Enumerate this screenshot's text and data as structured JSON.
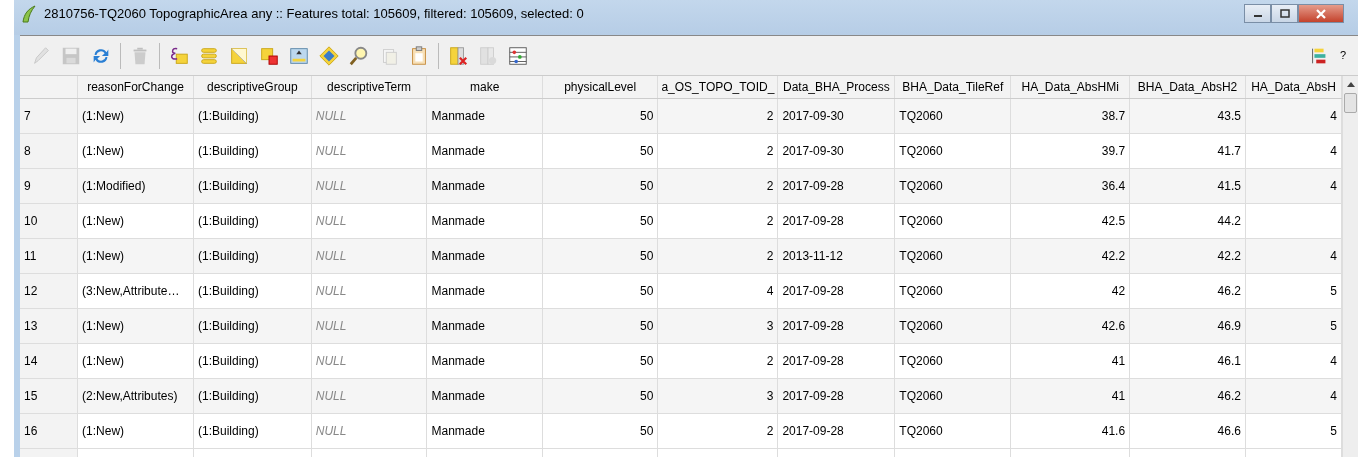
{
  "window": {
    "title": "2810756-TQ2060 TopographicArea any :: Features total: 105609, filtered: 105609, selected: 0"
  },
  "toolbar": {
    "groups": [
      [
        {
          "disabled": true
        },
        {
          "disabled": true
        },
        {
          "disabled": false
        }
      ],
      [
        {
          "disabled": true
        }
      ],
      [
        {
          "disabled": false
        },
        {
          "disabled": false
        },
        {
          "disabled": false
        },
        {
          "disabled": false
        },
        {
          "disabled": false
        },
        {
          "disabled": false
        },
        {
          "disabled": false
        },
        {
          "disabled": true
        },
        {
          "disabled": false
        }
      ],
      [
        {
          "disabled": false
        },
        {
          "disabled": true
        },
        {
          "disabled": false
        }
      ]
    ],
    "help": "?"
  },
  "table": {
    "columns": [
      {
        "label": "reasonForChange",
        "kind": "text"
      },
      {
        "label": "descriptiveGroup",
        "kind": "text"
      },
      {
        "label": "descriptiveTerm",
        "kind": "null"
      },
      {
        "label": "make",
        "kind": "text"
      },
      {
        "label": "physicalLevel",
        "kind": "number"
      },
      {
        "label": "a_OS_TOPO_TOID_",
        "kind": "number"
      },
      {
        "label": "Data_BHA_Process",
        "kind": "text"
      },
      {
        "label": "BHA_Data_TileRef",
        "kind": "text"
      },
      {
        "label": "HA_Data_AbsHMi",
        "kind": "number"
      },
      {
        "label": "BHA_Data_AbsH2",
        "kind": "number"
      },
      {
        "label": "HA_Data_AbsH",
        "kind": "number"
      }
    ],
    "rows": [
      {
        "id": "7",
        "cells": [
          "(1:New)",
          "(1:Building)",
          "NULL",
          "Manmade",
          "50",
          "2",
          "2017-09-30",
          "TQ2060",
          "38.7",
          "43.5",
          "4"
        ]
      },
      {
        "id": "8",
        "cells": [
          "(1:New)",
          "(1:Building)",
          "NULL",
          "Manmade",
          "50",
          "2",
          "2017-09-30",
          "TQ2060",
          "39.7",
          "41.7",
          "4"
        ]
      },
      {
        "id": "9",
        "cells": [
          "(1:Modified)",
          "(1:Building)",
          "NULL",
          "Manmade",
          "50",
          "2",
          "2017-09-28",
          "TQ2060",
          "36.4",
          "41.5",
          "4"
        ]
      },
      {
        "id": "10",
        "cells": [
          "(1:New)",
          "(1:Building)",
          "NULL",
          "Manmade",
          "50",
          "2",
          "2017-09-28",
          "TQ2060",
          "42.5",
          "44.2",
          null
        ]
      },
      {
        "id": "11",
        "cells": [
          "(1:New)",
          "(1:Building)",
          "NULL",
          "Manmade",
          "50",
          "2",
          "2013-11-12",
          "TQ2060",
          "42.2",
          "42.2",
          "4"
        ]
      },
      {
        "id": "12",
        "cells": [
          "(3:New,Attribute…",
          "(1:Building)",
          "NULL",
          "Manmade",
          "50",
          "4",
          "2017-09-28",
          "TQ2060",
          "42",
          "46.2",
          "5"
        ]
      },
      {
        "id": "13",
        "cells": [
          "(1:New)",
          "(1:Building)",
          "NULL",
          "Manmade",
          "50",
          "3",
          "2017-09-28",
          "TQ2060",
          "42.6",
          "46.9",
          "5"
        ]
      },
      {
        "id": "14",
        "cells": [
          "(1:New)",
          "(1:Building)",
          "NULL",
          "Manmade",
          "50",
          "2",
          "2017-09-28",
          "TQ2060",
          "41",
          "46.1",
          "4"
        ]
      },
      {
        "id": "15",
        "cells": [
          "(2:New,Attributes)",
          "(1:Building)",
          "NULL",
          "Manmade",
          "50",
          "3",
          "2017-09-28",
          "TQ2060",
          "41",
          "46.2",
          "4"
        ]
      },
      {
        "id": "16",
        "cells": [
          "(1:New)",
          "(1:Building)",
          "NULL",
          "Manmade",
          "50",
          "2",
          "2017-09-28",
          "TQ2060",
          "41.6",
          "46.6",
          "5"
        ]
      }
    ]
  }
}
